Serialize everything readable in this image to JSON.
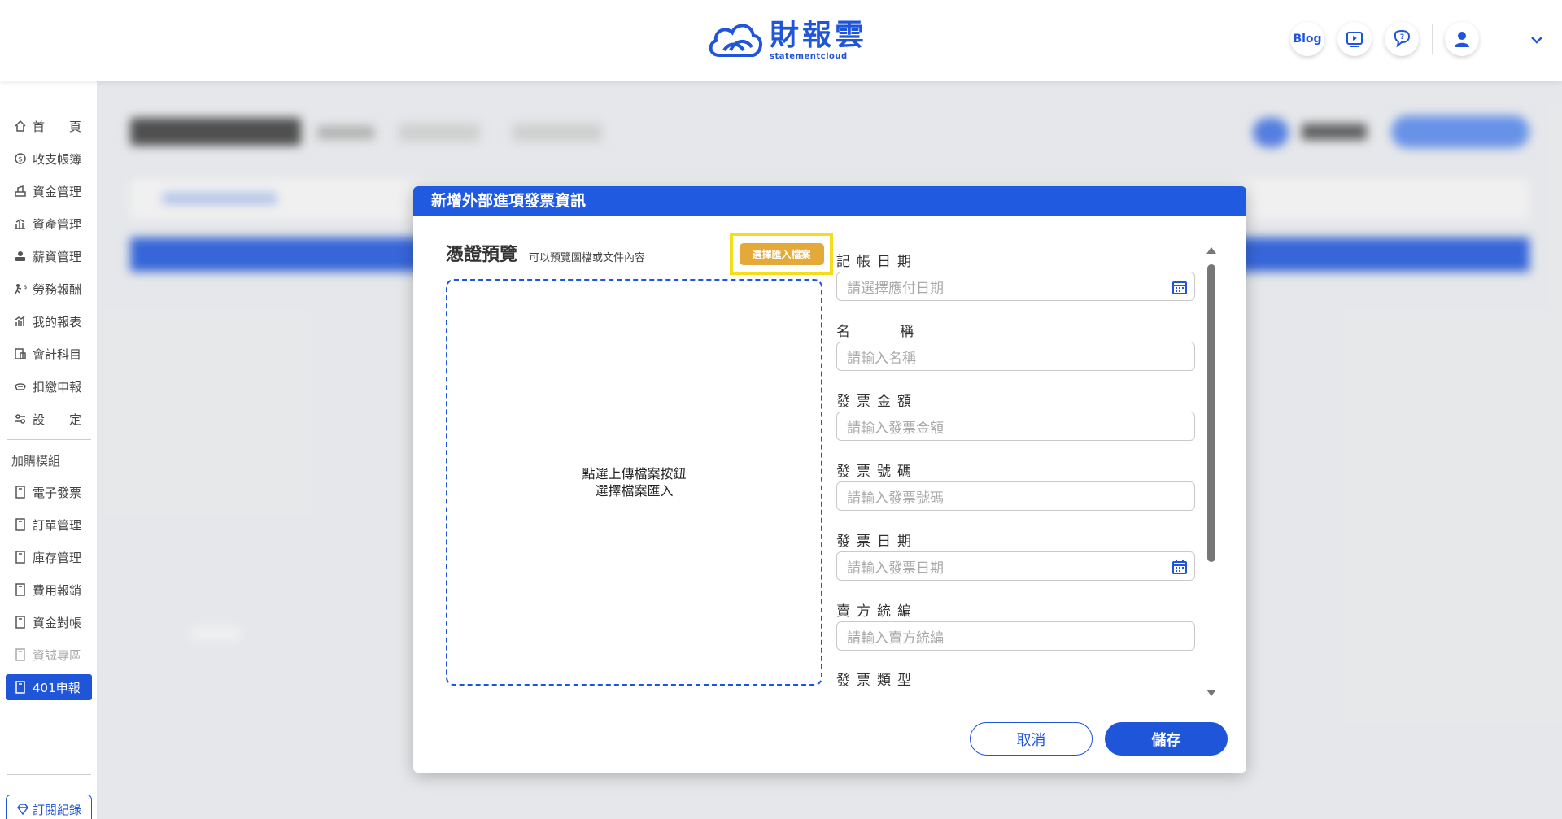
{
  "header": {
    "logo_title": "財報雲",
    "logo_sub": "statementcloud",
    "blog_label": "Blog"
  },
  "sidebar": {
    "items": [
      {
        "label": "首　　頁",
        "icon": "home-icon"
      },
      {
        "label": "收支帳簿",
        "icon": "coin-icon"
      },
      {
        "label": "資金管理",
        "icon": "fund-icon"
      },
      {
        "label": "資產管理",
        "icon": "asset-icon"
      },
      {
        "label": "薪資管理",
        "icon": "salary-icon"
      },
      {
        "label": "勞務報酬",
        "icon": "labor-icon"
      },
      {
        "label": "我的報表",
        "icon": "report-icon"
      },
      {
        "label": "會計科目",
        "icon": "ledger-icon"
      },
      {
        "label": "扣繳申報",
        "icon": "tax-icon"
      },
      {
        "label": "設　　定",
        "icon": "settings-icon"
      }
    ],
    "group_title": "加購模組",
    "modules": [
      {
        "label": "電子發票",
        "icon": "book-icon"
      },
      {
        "label": "訂單管理",
        "icon": "book-icon"
      },
      {
        "label": "庫存管理",
        "icon": "book-icon"
      },
      {
        "label": "費用報銷",
        "icon": "book-icon"
      },
      {
        "label": "資金對帳",
        "icon": "book-icon"
      },
      {
        "label": "資誠專區",
        "icon": "book-icon"
      },
      {
        "label": "401申報",
        "icon": "book-icon"
      }
    ],
    "subscription_label": "訂閱紀錄"
  },
  "modal": {
    "title": "新增外部進項發票資訊",
    "preview_title": "憑證預覽",
    "preview_sub": "可以預覽圖檔或文件內容",
    "import_button": "選擇匯入檔案",
    "dropzone_line1": "點選上傳檔案按鈕",
    "dropzone_line2": "選擇檔案匯入",
    "fields": [
      {
        "label": "記帳日期",
        "placeholder": "請選擇應付日期",
        "calendar": true
      },
      {
        "label": "名　稱",
        "placeholder": "請輸入名稱",
        "calendar": false
      },
      {
        "label": "發票金額",
        "placeholder": "請輸入發票金額",
        "calendar": false
      },
      {
        "label": "發票號碼",
        "placeholder": "請輸入發票號碼",
        "calendar": false
      },
      {
        "label": "發票日期",
        "placeholder": "請輸入發票日期",
        "calendar": true
      },
      {
        "label": "賣方統編",
        "placeholder": "請輸入賣方統編",
        "calendar": false
      },
      {
        "label": "發票類型",
        "placeholder": "",
        "calendar": false
      }
    ],
    "cancel_label": "取消",
    "save_label": "儲存"
  },
  "colors": {
    "primary": "#1f55d8",
    "header_blue": "#1f5ae0",
    "import_orange": "#e4a938",
    "highlight_yellow": "#f5dd1b"
  }
}
